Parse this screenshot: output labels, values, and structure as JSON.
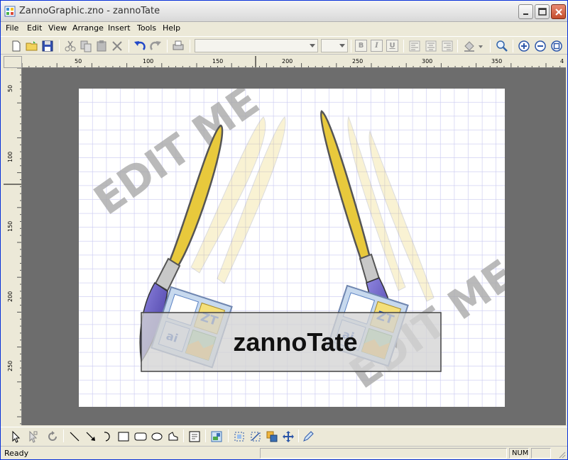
{
  "window": {
    "title": "ZannoGraphic.zno - zannoTate"
  },
  "menu": [
    "File",
    "Edit",
    "View",
    "Arrange",
    "Insert",
    "Tools",
    "Help"
  ],
  "toolbar": {
    "font_value": "",
    "size_value": "",
    "bold": "B",
    "italic": "I",
    "underline": "U"
  },
  "ruler": {
    "top_labels": [
      "50",
      "100",
      "150",
      "200",
      "250",
      "300",
      "350",
      "4"
    ],
    "left_labels": [
      "50",
      "100",
      "150",
      "200",
      "250"
    ]
  },
  "canvas": {
    "watermark_1": "EDIT ME",
    "watermark_2": "EDIT ME",
    "banner_text": "zannoTate",
    "logo_icon_text_1": "ZT",
    "logo_icon_text_2": "ai"
  },
  "status": {
    "ready": "Ready",
    "num": "NUM"
  },
  "colors": {
    "titlebar_border": "#0831d9",
    "canvas_bg": "#6d6d6d",
    "grid": "#c8c8f0",
    "brush_yellow": "#e8c93c",
    "brush_blue": "#5a4fb3"
  },
  "icons": [
    "new-document-icon",
    "open-folder-icon",
    "save-icon",
    "cut-icon",
    "copy-icon",
    "paste-icon",
    "delete-icon",
    "undo-icon",
    "redo-icon",
    "print-icon",
    "align-left-icon",
    "align-center-icon",
    "align-right-icon",
    "fill-color-icon",
    "zoom-icon",
    "zoom-in-icon",
    "zoom-out-icon",
    "zoom-fit-icon"
  ]
}
